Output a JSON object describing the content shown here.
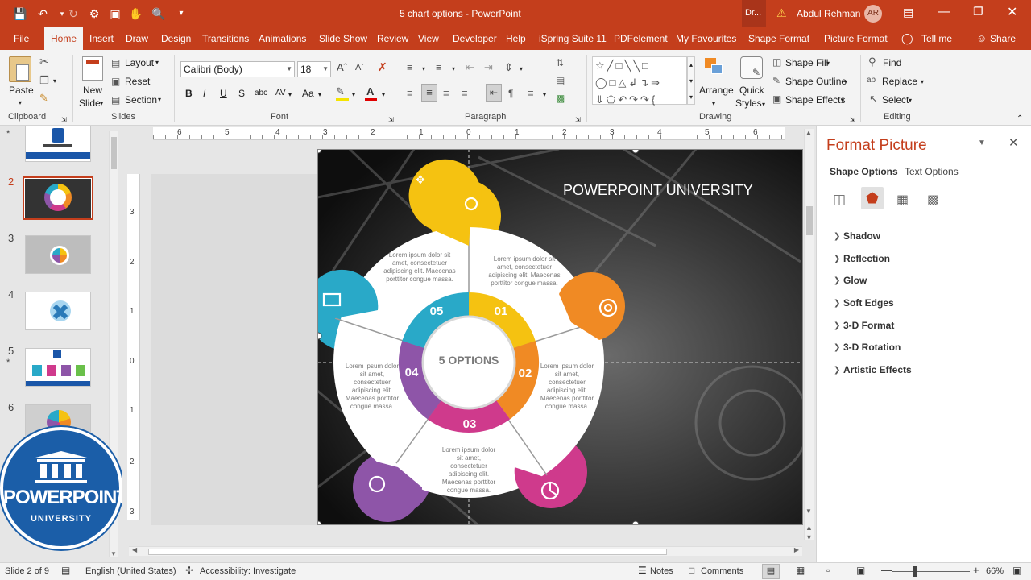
{
  "window": {
    "doc_title": "5 chart options - PowerPoint",
    "dr_label": "Dr...",
    "warning_icon": "warning-icon",
    "user_name": "Abdul Rehman",
    "user_initials": "AR"
  },
  "tabs": [
    "File",
    "Home",
    "Insert",
    "Draw",
    "Design",
    "Transitions",
    "Animations",
    "Slide Show",
    "Review",
    "View",
    "Developer",
    "Help",
    "iSpring Suite 11",
    "PDFelement",
    "My Favourites",
    "Shape Format",
    "Picture Format",
    "Tell me",
    "Share"
  ],
  "ribbon": {
    "clipboard": {
      "label": "Clipboard",
      "paste": "Paste"
    },
    "slides": {
      "label": "Slides",
      "new_slide_line1": "New",
      "new_slide_line2": "Slide",
      "layout": "Layout",
      "reset": "Reset",
      "section": "Section"
    },
    "font": {
      "label": "Font",
      "font_name": "Calibri (Body)",
      "font_size": "18",
      "bold": "B",
      "italic": "I",
      "underline": "U",
      "shadow": "S",
      "strike": "abc",
      "spacing": "AV",
      "case": "Aa",
      "color_a": "A"
    },
    "paragraph": {
      "label": "Paragraph"
    },
    "drawing": {
      "label": "Drawing",
      "arrange": "Arrange",
      "quick_styles_line1": "Quick",
      "quick_styles_line2": "Styles",
      "shape_fill": "Shape Fill",
      "shape_outline": "Shape Outline",
      "shape_effects": "Shape Effects"
    },
    "editing": {
      "label": "Editing",
      "find": "Find",
      "replace": "Replace",
      "select": "Select"
    }
  },
  "slides_pane": {
    "numbers": [
      "2",
      "3",
      "4",
      "5",
      "6"
    ],
    "star": "*",
    "current": "2"
  },
  "ruler": {
    "h_ticks": [
      "6",
      "5",
      "4",
      "3",
      "2",
      "1",
      "0",
      "1",
      "2",
      "3",
      "4",
      "5",
      "6"
    ],
    "v_ticks": [
      "3",
      "2",
      "1",
      "0",
      "1",
      "2",
      "3"
    ]
  },
  "slide": {
    "brand": "POWERPOINT UNIVERSITY",
    "center": "5 OPTIONS",
    "segments": [
      {
        "num": "01",
        "color": "#f5c211"
      },
      {
        "num": "02",
        "color": "#f08a24"
      },
      {
        "num": "03",
        "color": "#cf3a8c"
      },
      {
        "num": "04",
        "color": "#8e55a8"
      },
      {
        "num": "05",
        "color": "#29a9c8"
      }
    ],
    "texts": {
      "t05": "Lorem ipsum dolor sit amet, consectetuer adipiscing elit. Maecenas porttitor congue massa.",
      "t01": "Lorem ipsum dolor sit amet, consectetuer adipiscing elit. Maecenas porttitor congue massa.",
      "t04": "Lorem ipsum dolor sit amet, consectetuer adipiscing elit. Maecenas porttitor congue massa.",
      "t02": "Lorem ipsum dolor sit amet, consectetuer adipiscing elit. Maecenas porttitor congue massa.",
      "t03": "Lorem ipsum dolor sit amet, consectetuer adipiscing elit. Maecenas porttitor congue massa."
    },
    "icons": [
      "bulb-icon",
      "target-icon",
      "pie-chart-icon",
      "head-gear-icon",
      "presentation-icon"
    ]
  },
  "logo": {
    "top": "POWERPOINT",
    "bottom": "UNIVERSITY"
  },
  "format_pane": {
    "title": "Format Picture",
    "tab_shape": "Shape Options",
    "tab_text": "Text Options",
    "items": [
      "Shadow",
      "Reflection",
      "Glow",
      "Soft Edges",
      "3-D Format",
      "3-D Rotation",
      "Artistic Effects"
    ]
  },
  "status": {
    "slide": "Slide 2 of 9",
    "language": "English (United States)",
    "accessibility": "Accessibility: Investigate",
    "notes": "Notes",
    "comments": "Comments",
    "zoom": "66%"
  }
}
